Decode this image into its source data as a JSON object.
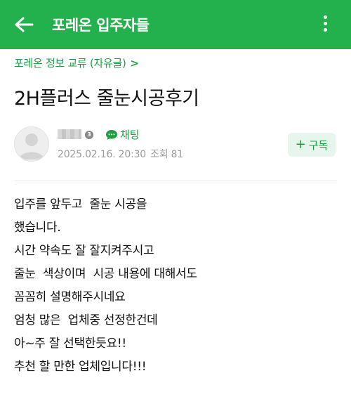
{
  "appbar": {
    "title": "포레온 입주자들",
    "color": "#22b14c",
    "back_icon": "arrow-left-icon",
    "more_icon": "more-vertical-icon"
  },
  "board": {
    "label": "포레온 정보 교류 (자유글)",
    "chevron": ">"
  },
  "post": {
    "title": "2H플러스 줄눈시공후기",
    "author": {
      "avatar_icon": "default-avatar-icon",
      "grade": "3"
    },
    "chat_label": "채팅",
    "date": "2025.02.16. 20:30",
    "views": "조회 81",
    "follow_label": "구독",
    "follow_plus": "+",
    "body_lines": [
      "입주를 앞두고  줄눈 시공을",
      "했습니다.",
      "시간 약속도 잘 잘지켜주시고",
      "줄눈  색상이며  시공 내용에 대해서도",
      "꼼꼼히 설명해주시네요",
      "엄청 많은  업체중 선정한건데",
      "아~주 잘 선택한듯요!!",
      "추천 할 만한 업체입니다!!!"
    ]
  },
  "accent_color": "#1f9d45"
}
